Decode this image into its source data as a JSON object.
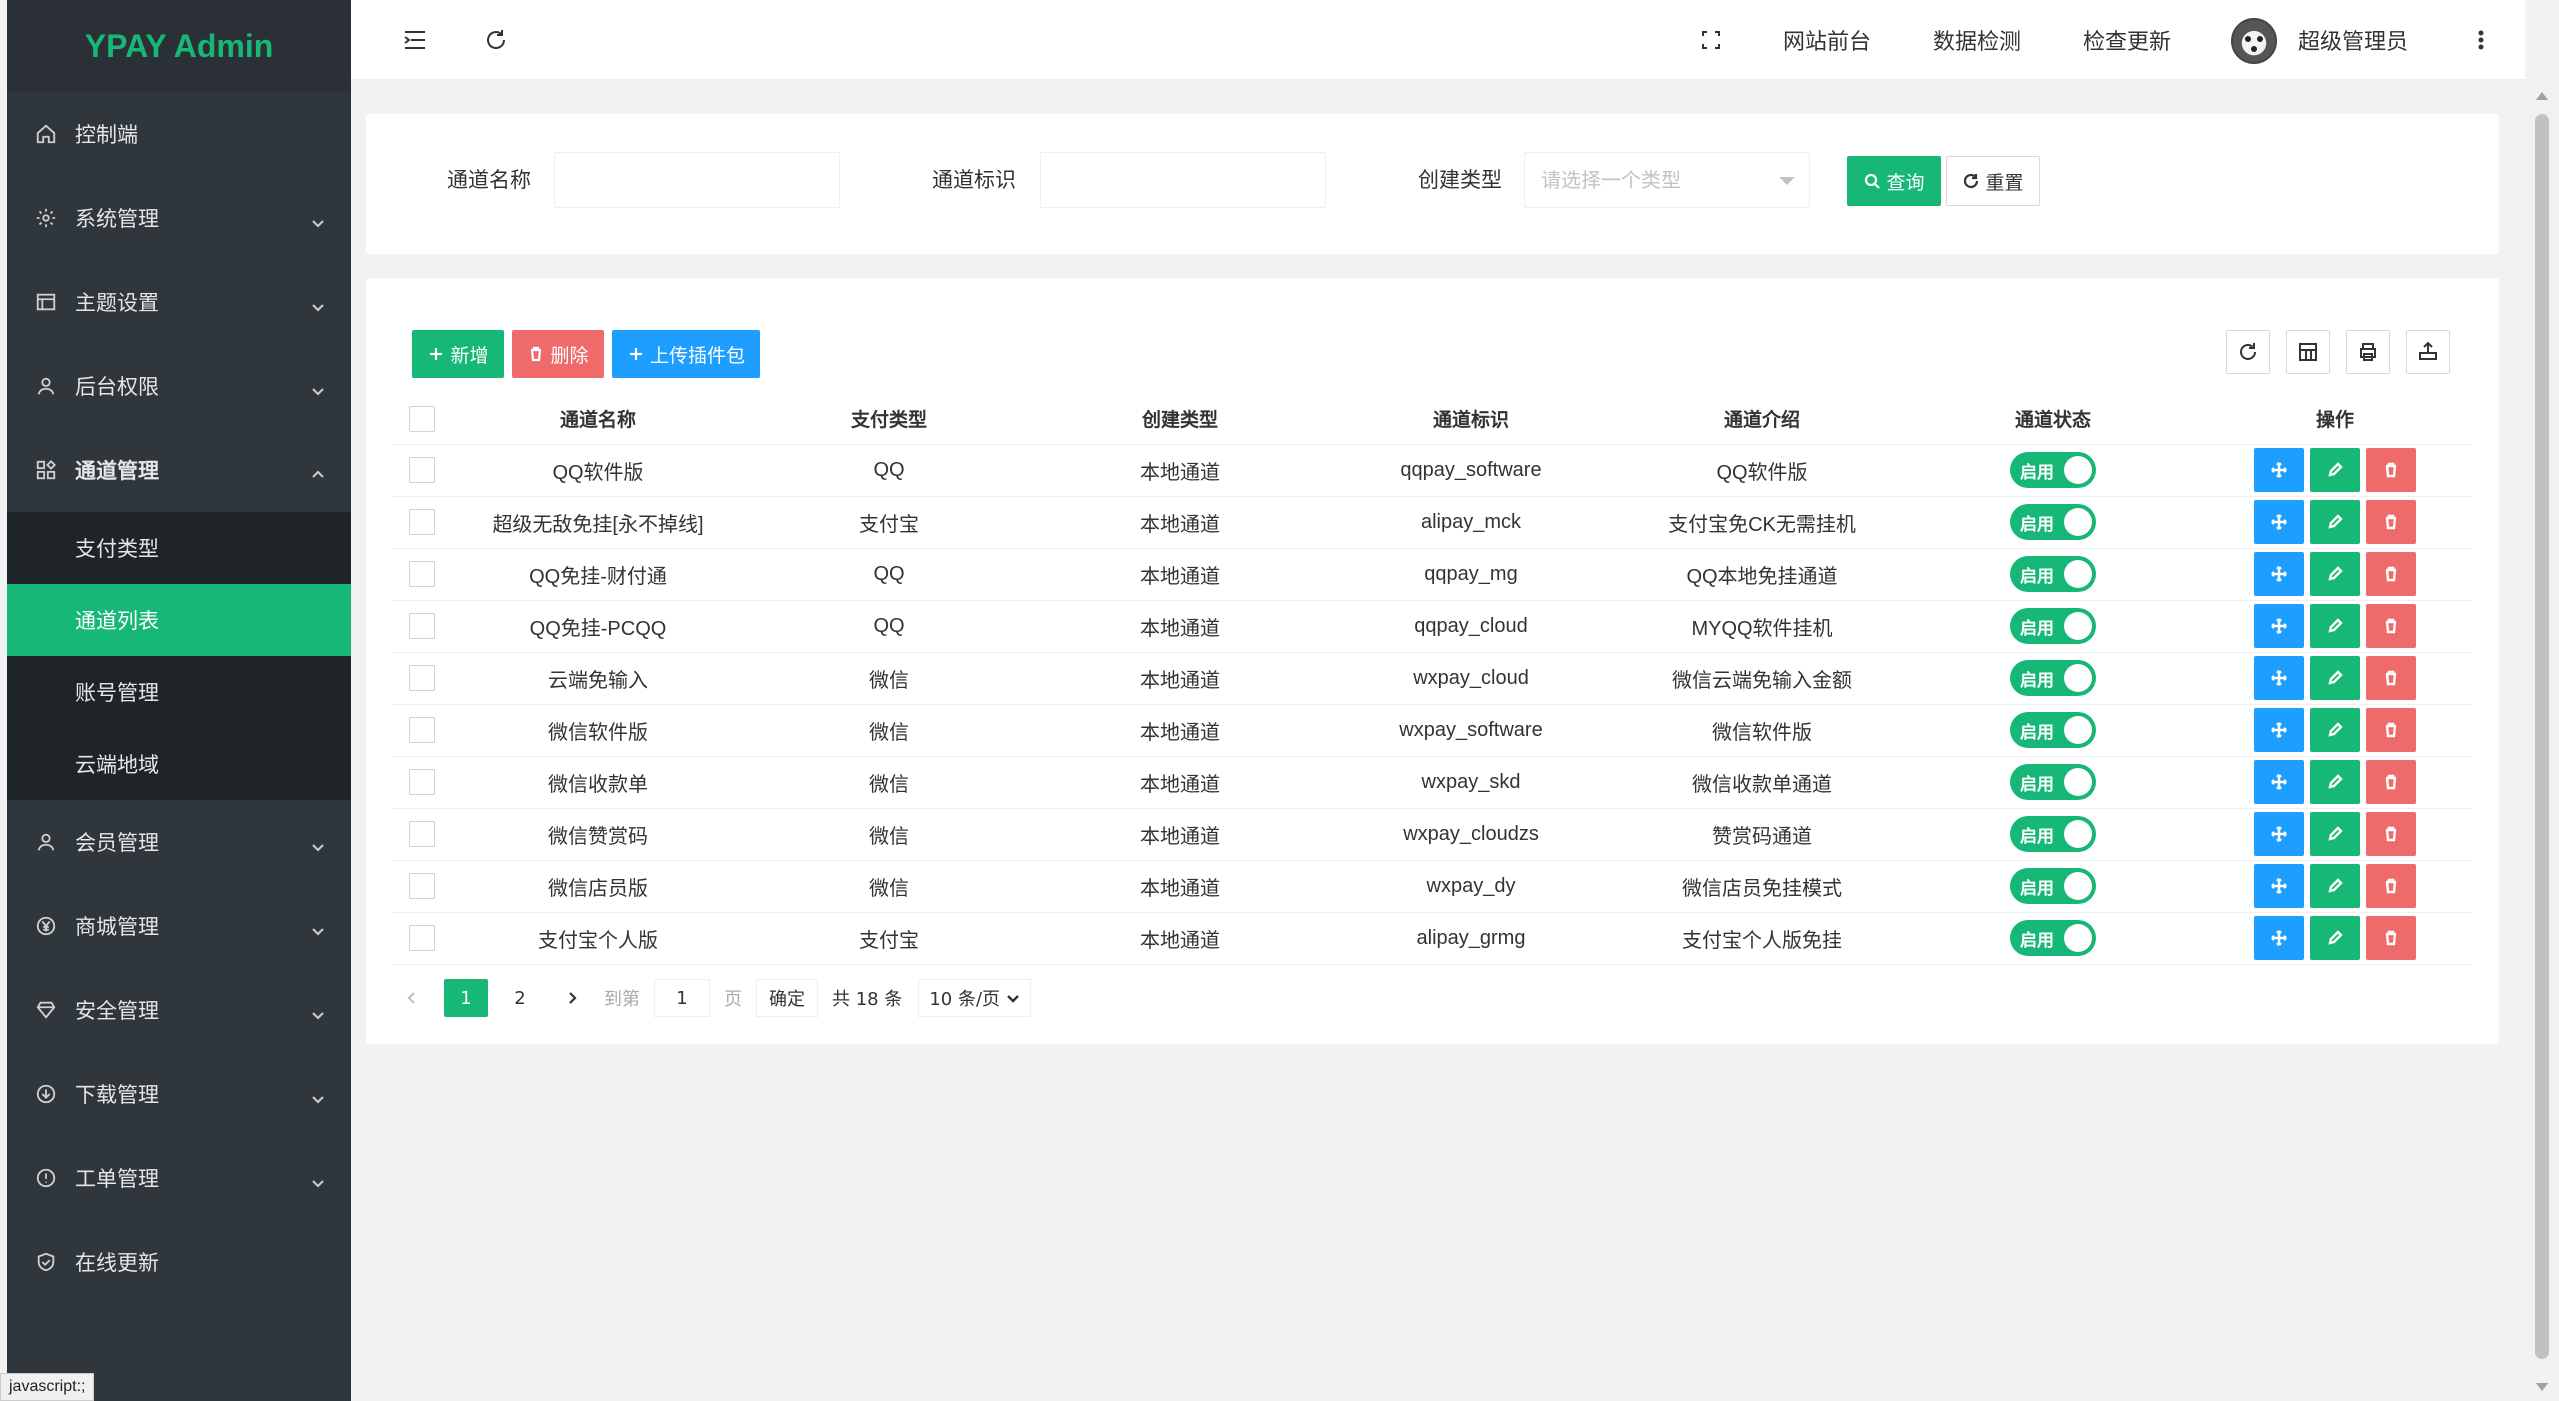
{
  "app": {
    "logo": "YPAY Admin"
  },
  "sidebar": {
    "items": [
      {
        "label": "控制端",
        "icon": "home-icon"
      },
      {
        "label": "系统管理",
        "icon": "gear-icon"
      },
      {
        "label": "主题设置",
        "icon": "window-icon"
      },
      {
        "label": "后台权限",
        "icon": "user-icon"
      },
      {
        "label": "通道管理",
        "icon": "apps-icon"
      },
      {
        "label": "会员管理",
        "icon": "user-icon"
      },
      {
        "label": "商城管理",
        "icon": "yen-icon"
      },
      {
        "label": "安全管理",
        "icon": "diamond-icon"
      },
      {
        "label": "下载管理",
        "icon": "download-icon"
      },
      {
        "label": "工单管理",
        "icon": "info-icon"
      },
      {
        "label": "在线更新",
        "icon": "shield-check-icon"
      }
    ],
    "submenu": [
      {
        "label": "支付类型"
      },
      {
        "label": "通道列表"
      },
      {
        "label": "账号管理"
      },
      {
        "label": "云端地域"
      }
    ]
  },
  "header": {
    "links": [
      "网站前台",
      "数据检测",
      "检查更新"
    ],
    "user": "超级管理员"
  },
  "search": {
    "name_label": "通道名称",
    "id_label": "通道标识",
    "type_label": "创建类型",
    "type_placeholder": "请选择一个类型",
    "query_label": "查询",
    "reset_label": "重置"
  },
  "toolbar": {
    "add_label": "新增",
    "delete_label": "删除",
    "upload_label": "上传插件包"
  },
  "table": {
    "columns": [
      "通道名称",
      "支付类型",
      "创建类型",
      "通道标识",
      "通道介绍",
      "通道状态",
      "操作"
    ],
    "rows": [
      {
        "name": "QQ软件版",
        "pay": "QQ",
        "create": "本地通道",
        "id": "qqpay_software",
        "desc": "QQ软件版",
        "status": "启用"
      },
      {
        "name": "超级无敌免挂[永不掉线]",
        "pay": "支付宝",
        "create": "本地通道",
        "id": "alipay_mck",
        "desc": "支付宝免CK无需挂机",
        "status": "启用"
      },
      {
        "name": "QQ免挂-财付通",
        "pay": "QQ",
        "create": "本地通道",
        "id": "qqpay_mg",
        "desc": "QQ本地免挂通道",
        "status": "启用"
      },
      {
        "name": "QQ免挂-PCQQ",
        "pay": "QQ",
        "create": "本地通道",
        "id": "qqpay_cloud",
        "desc": "MYQQ软件挂机",
        "status": "启用"
      },
      {
        "name": "云端免输入",
        "pay": "微信",
        "create": "本地通道",
        "id": "wxpay_cloud",
        "desc": "微信云端免输入金额",
        "status": "启用"
      },
      {
        "name": "微信软件版",
        "pay": "微信",
        "create": "本地通道",
        "id": "wxpay_software",
        "desc": "微信软件版",
        "status": "启用"
      },
      {
        "name": "微信收款单",
        "pay": "微信",
        "create": "本地通道",
        "id": "wxpay_skd",
        "desc": "微信收款单通道",
        "status": "启用"
      },
      {
        "name": "微信赞赏码",
        "pay": "微信",
        "create": "本地通道",
        "id": "wxpay_cloudzs",
        "desc": "赞赏码通道",
        "status": "启用"
      },
      {
        "name": "微信店员版",
        "pay": "微信",
        "create": "本地通道",
        "id": "wxpay_dy",
        "desc": "微信店员免挂模式",
        "status": "启用"
      },
      {
        "name": "支付宝个人版",
        "pay": "支付宝",
        "create": "本地通道",
        "id": "alipay_grmg",
        "desc": "支付宝个人版免挂",
        "status": "启用"
      }
    ]
  },
  "pager": {
    "page1": "1",
    "page2": "2",
    "goto_label": "到第",
    "goto_value": "1",
    "page_suffix": "页",
    "confirm": "确定",
    "total": "共 18 条",
    "per_page": "10 条/页"
  },
  "status_bar": "javascript:;",
  "colors": {
    "accent": "#16b777",
    "blue": "#1e9fff",
    "red": "#ef6b6b",
    "sidebar": "#2f363c"
  }
}
